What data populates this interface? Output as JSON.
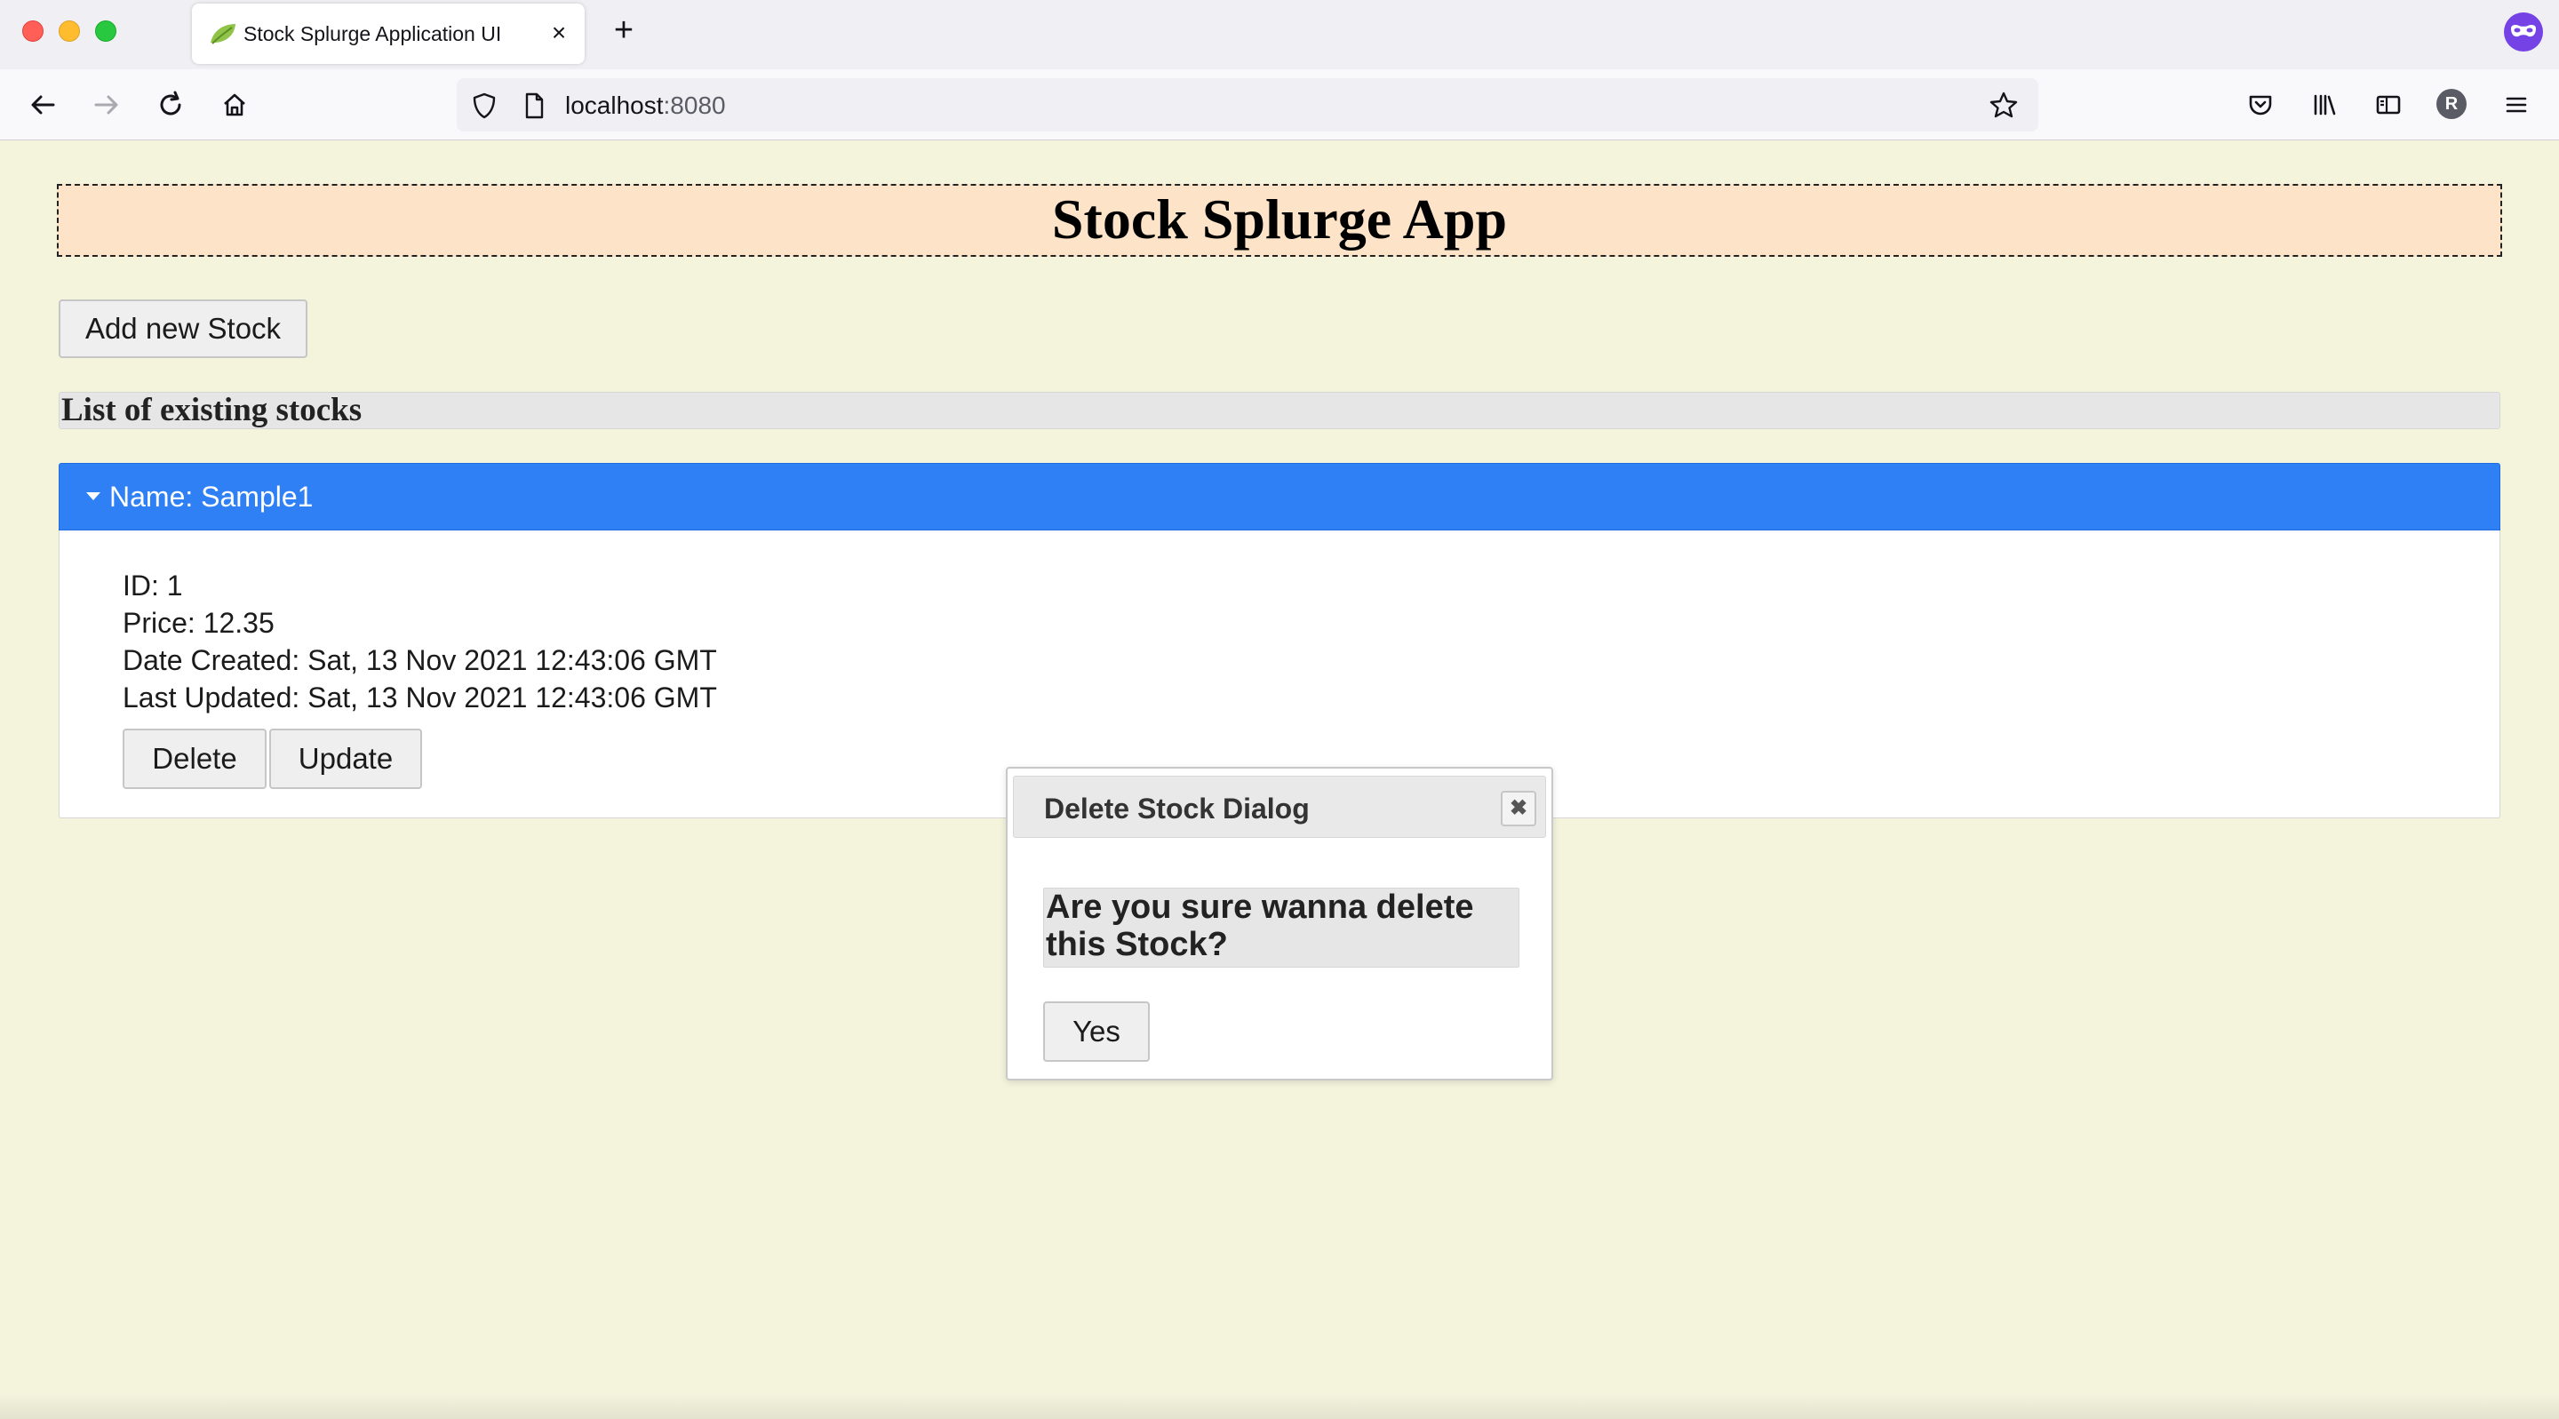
{
  "browser": {
    "tab_title": "Stock Splurge Application UI",
    "tab_close": "×",
    "new_tab": "+",
    "url_host": "localhost",
    "url_port": ":8080",
    "profile_initial": "R"
  },
  "app": {
    "title": "Stock Splurge App",
    "add_button": "Add new Stock",
    "list_heading": "List of existing stocks"
  },
  "stock": {
    "name_label": "Name: Sample1",
    "id_line": "ID: 1",
    "price_line": "Price: 12.35",
    "created_line": "Date Created: Sat, 13 Nov 2021 12:43:06 GMT",
    "updated_line": "Last Updated: Sat, 13 Nov 2021 12:43:06 GMT",
    "delete_button": "Delete",
    "update_button": "Update"
  },
  "dialog": {
    "title": "Delete Stock Dialog",
    "close_glyph": "✖",
    "question": "Are you sure wanna delete this Stock?",
    "yes_button": "Yes"
  },
  "colors": {
    "page_background": "#f4f3dc",
    "header_background": "#fde3c8",
    "accordion_header": "#2f80f4"
  }
}
